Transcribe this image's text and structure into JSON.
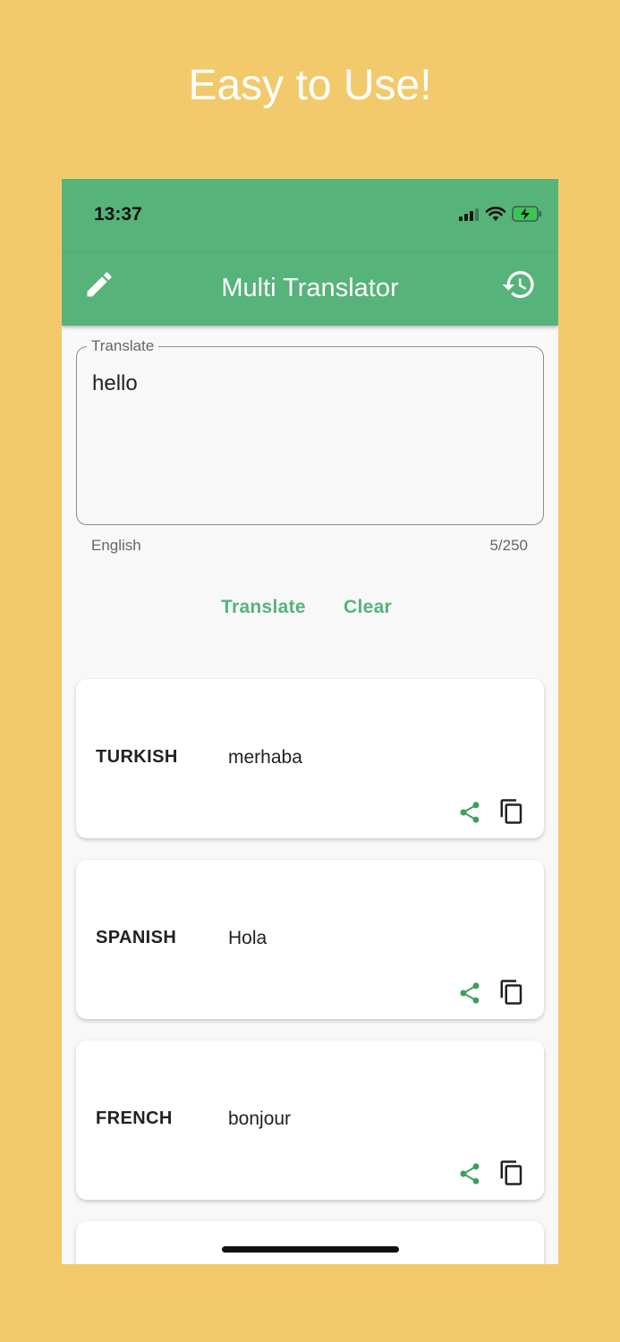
{
  "promo": {
    "title": "Easy to Use!"
  },
  "status_bar": {
    "time": "13:37",
    "icons": [
      "signal-icon",
      "wifi-icon",
      "battery-charging-icon"
    ]
  },
  "app_bar": {
    "title": "Multi Translator",
    "left_icon": "edit-icon",
    "right_icon": "history-icon"
  },
  "input": {
    "label": "Translate",
    "value": "hello",
    "source_language": "English",
    "char_count": "5/250"
  },
  "actions": {
    "translate_label": "Translate",
    "clear_label": "Clear"
  },
  "results": [
    {
      "language": "TURKISH",
      "text": "merhaba"
    },
    {
      "language": "SPANISH",
      "text": "Hola"
    },
    {
      "language": "FRENCH",
      "text": "bonjour"
    }
  ],
  "colors": {
    "background": "#f2ca6b",
    "accent": "#56b37a",
    "card": "#ffffff"
  }
}
